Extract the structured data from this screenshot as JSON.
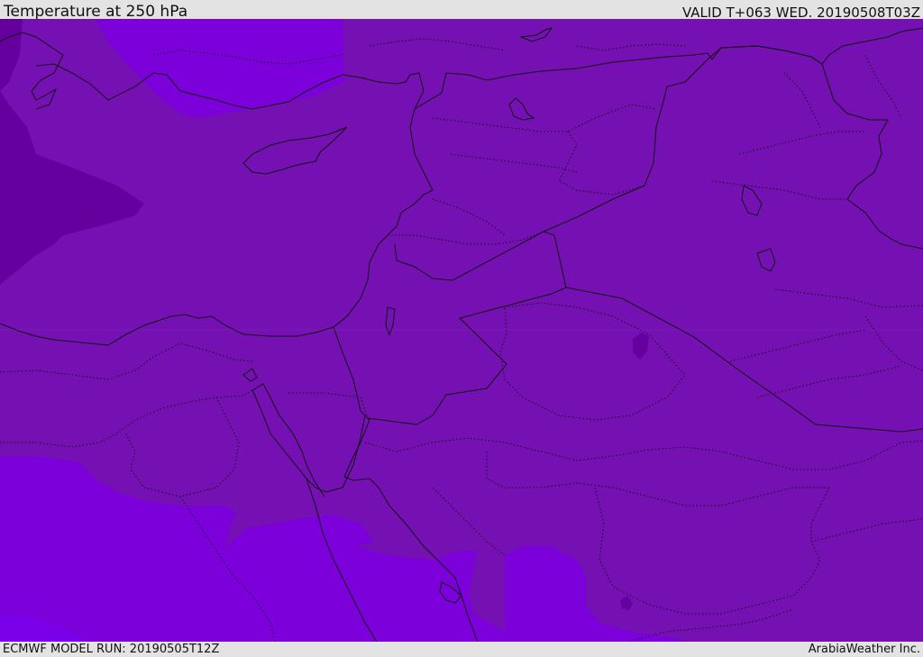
{
  "header": {
    "title": "Temperature at 250 hPa",
    "valid": "VALID T+063 WED. 20190508T03Z"
  },
  "footer": {
    "model_run": "ECMWF MODEL RUN: 20190505T12Z",
    "provider": "ArabiaWeather Inc."
  },
  "colors": {
    "base_field": "#7511b3",
    "cold_lobe": "#65009e",
    "warm_bright": "#7b00d9",
    "warm_brighter": "#7a00ea",
    "border_line": "#111111"
  }
}
